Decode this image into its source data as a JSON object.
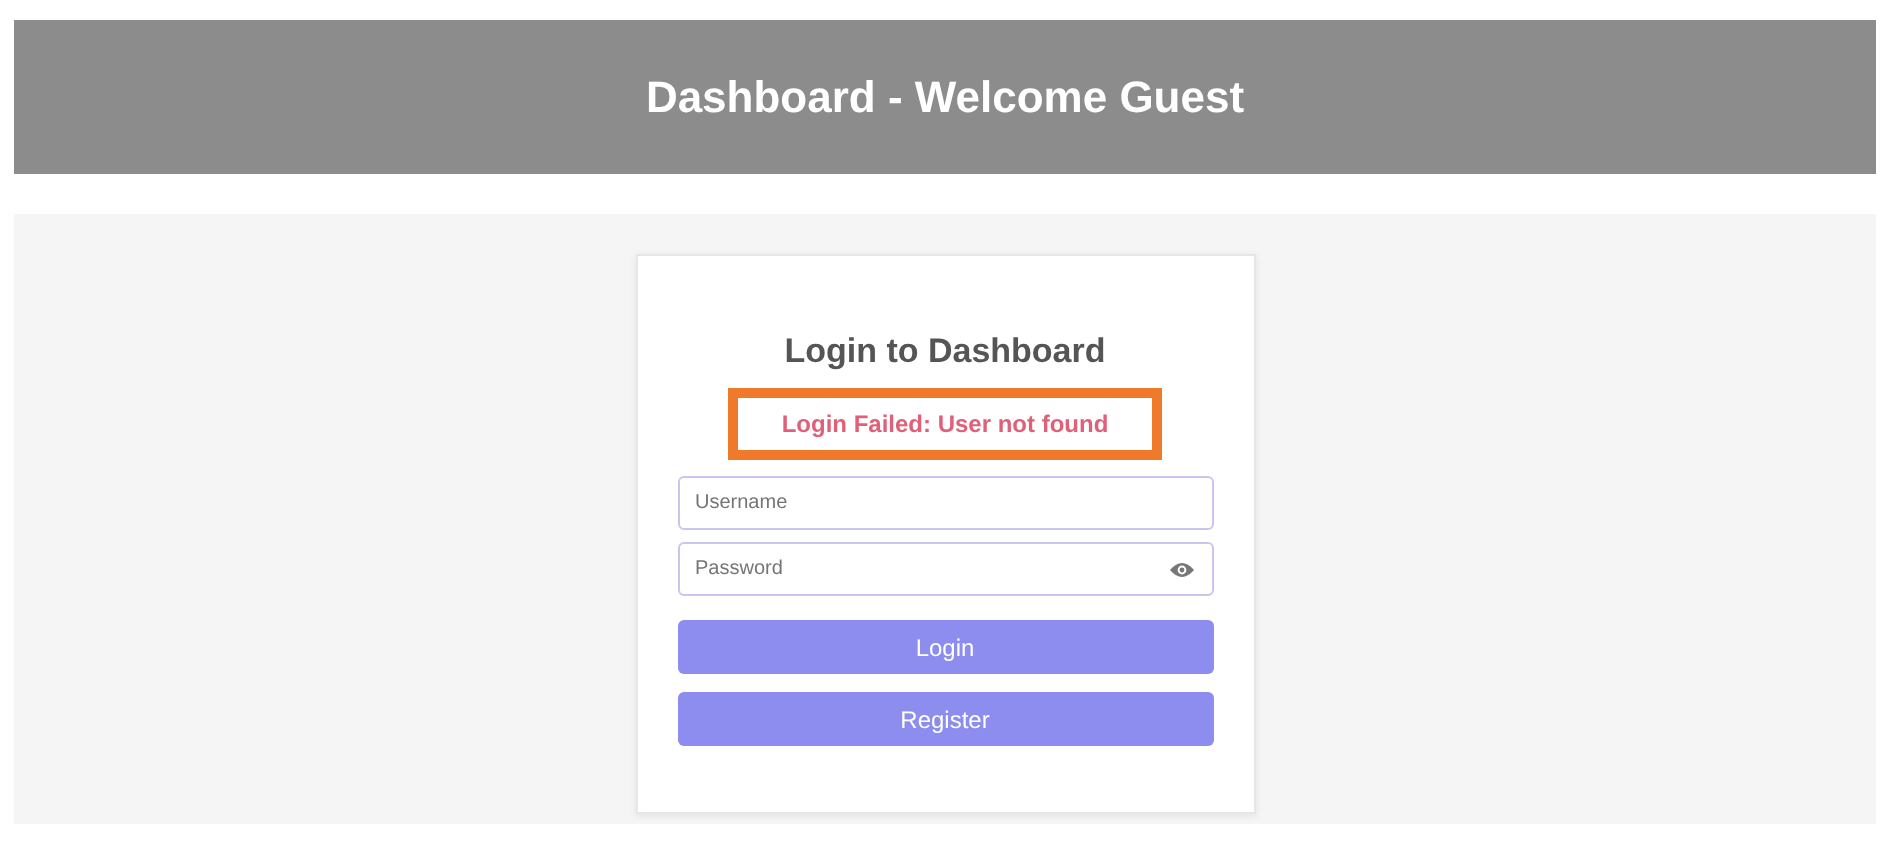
{
  "header": {
    "title": "Dashboard - Welcome Guest"
  },
  "login_card": {
    "title": "Login to Dashboard",
    "error_message": {
      "text": "Login Failed: User not found",
      "highlighted": true
    },
    "username_field": {
      "placeholder": "Username"
    },
    "password_field": {
      "placeholder": "Password"
    },
    "buttons": [
      {
        "label": "Login"
      },
      {
        "label": "Register"
      }
    ]
  }
}
